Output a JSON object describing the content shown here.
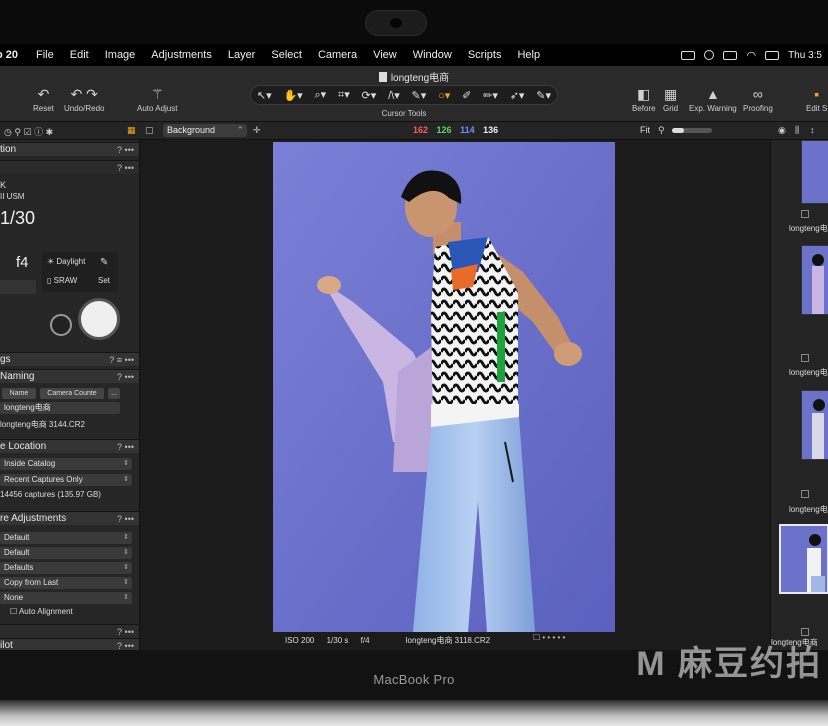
{
  "menubar": {
    "app_name": "o 20",
    "items": [
      "File",
      "Edit",
      "Image",
      "Adjustments",
      "Layer",
      "Select",
      "Camera",
      "View",
      "Window",
      "Scripts",
      "Help"
    ],
    "clock": "Thu 3:5"
  },
  "window": {
    "title": "longteng电商"
  },
  "toolbar": {
    "reset_label": "Reset",
    "undo_redo_label": "Undo/Redo",
    "auto_adjust_label": "Auto Adjust",
    "cursor_tools_label": "Cursor Tools",
    "before_label": "Before",
    "grid_label": "Grid",
    "exp_warning_label": "Exp. Warning",
    "proofing_label": "Proofing",
    "edit_label": "Edit S"
  },
  "subbar": {
    "layer_select": "Background",
    "rgb": {
      "r": "162",
      "g": "126",
      "b": "114",
      "l": "136"
    },
    "fit_label": "Fit"
  },
  "colors": {
    "r": "#ff5a5a",
    "g": "#5fd35f",
    "b": "#6f8dff",
    "accent": "#f5a623",
    "backdrop": "#6c72c9"
  },
  "left_panel": {
    "camera_header": "tion",
    "lens_k": "K",
    "lens": "II USM",
    "shutter": "1/30",
    "aperture": "f4",
    "wb_daylight": "Daylight",
    "wb_sraw": "SRAW",
    "wb_set": "Set",
    "settings_header": "gs",
    "naming_header": "Naming",
    "naming_btn_name": "Name",
    "naming_btn_counter": "Camera Counte",
    "naming_btn_more": "...",
    "session_name": "longteng电商",
    "sample_file": "longteng电商 3144.CR2",
    "location_header": "e Location",
    "location_value": "Inside Catalog",
    "captures_value": "Recent Captures Only",
    "captures_count": "14456 captures (135.97 GB)",
    "adjustments_header": "re Adjustments",
    "adj_1": "Default",
    "adj_2": "Default",
    "adj_3": "Defaults",
    "adj_4": "Copy from Last",
    "adj_5": "None",
    "auto_alignment": "Auto Alignment",
    "pilot_header": "ilot"
  },
  "viewer": {
    "iso": "ISO 200",
    "shutter": "1/30 s",
    "aperture": "f/4",
    "filename": "longteng电商 3118.CR2"
  },
  "browser": {
    "labels": [
      "longteng电商",
      "longteng电商",
      "longteng电商 :",
      "longteng电商"
    ]
  },
  "bezel": {
    "label": "MacBook Pro"
  },
  "watermark": "M 麻豆约拍"
}
